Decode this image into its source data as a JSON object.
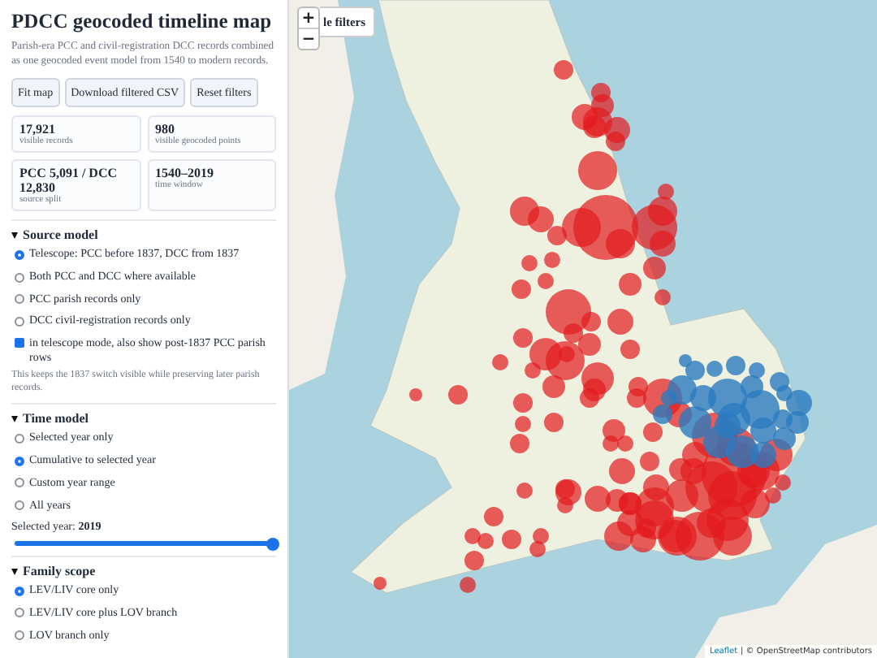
{
  "sidebar": {
    "title": "PDCC geocoded timeline map",
    "description": "Parish-era PCC and civil-registration DCC records combined as one geocoded event model from 1540 to modern records.",
    "buttons": [
      "Fit map",
      "Download filtered CSV",
      "Reset filters"
    ],
    "stats": [
      {
        "value": "17,921",
        "label": "visible records"
      },
      {
        "value": "980",
        "label": "visible geocoded points"
      },
      {
        "value": "PCC 5,091 / DCC 12,830",
        "label": "source split"
      },
      {
        "value": "1540–2019",
        "label": "time window"
      }
    ],
    "sections": [
      {
        "title": "Source model",
        "expanded": true,
        "items": [
          {
            "kind": "radio",
            "label": "Telescope: PCC before 1837, DCC from 1837",
            "selected": true
          },
          {
            "kind": "radio",
            "label": "Both PCC and DCC where available",
            "selected": false
          },
          {
            "kind": "radio",
            "label": "PCC parish records only",
            "selected": false
          },
          {
            "kind": "radio",
            "label": "DCC civil-registration records only",
            "selected": false
          },
          {
            "kind": "checkbox",
            "label": "in telescope mode, also show post-1837 PCC parish rows",
            "checked": true
          },
          {
            "kind": "note",
            "label": "This keeps the 1837 switch visible while preserving later parish records."
          }
        ]
      },
      {
        "title": "Time model",
        "expanded": true,
        "items": [
          {
            "kind": "radio",
            "label": "Selected year only",
            "selected": false
          },
          {
            "kind": "radio",
            "label": "Cumulative to selected year",
            "selected": true
          },
          {
            "kind": "radio",
            "label": "Custom year range",
            "selected": false
          },
          {
            "kind": "radio",
            "label": "All years",
            "selected": false
          },
          {
            "kind": "slider",
            "label": "Selected year:",
            "value": "2019",
            "level": 1.0
          }
        ]
      },
      {
        "title": "Family scope",
        "expanded": true,
        "items": [
          {
            "kind": "radio",
            "label": "LEV/LIV core only",
            "selected": true
          },
          {
            "kind": "radio",
            "label": "LEV/LIV core plus LOV branch",
            "selected": false
          },
          {
            "kind": "radio",
            "label": "LOV branch only",
            "selected": false
          }
        ]
      }
    ]
  },
  "map": {
    "toggle_button": "le filters",
    "zoom_in": "+",
    "zoom_out": "−",
    "attribution_link": "Leaflet",
    "attribution": "| © OpenStreetMap contributors"
  }
}
